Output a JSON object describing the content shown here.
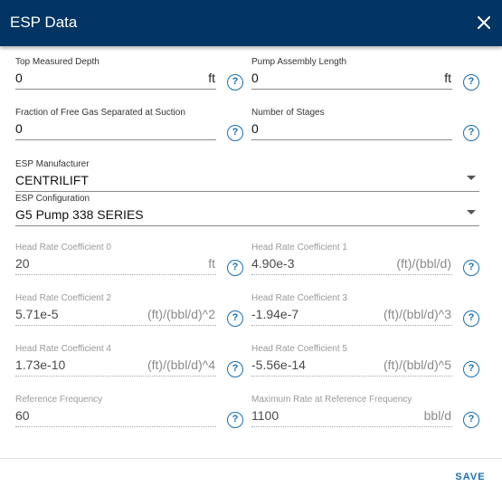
{
  "dialog": {
    "title": "ESP Data",
    "save_label": "SAVE"
  },
  "fields": {
    "top_measured_depth": {
      "label": "Top Measured Depth",
      "value": "0",
      "unit": "ft"
    },
    "pump_assembly_length": {
      "label": "Pump Assembly Length",
      "value": "0",
      "unit": "ft"
    },
    "free_gas_fraction": {
      "label": "Fraction of Free Gas Separated at Suction",
      "value": "0"
    },
    "number_of_stages": {
      "label": "Number of Stages",
      "value": "0"
    },
    "esp_manufacturer": {
      "label": "ESP Manufacturer",
      "value": "CENTRILIFT"
    },
    "esp_configuration": {
      "label": "ESP Configuration",
      "value": "G5 Pump 338 SERIES"
    },
    "head_rate_coef_0": {
      "label": "Head Rate Coefficient 0",
      "value": "20",
      "unit": "ft"
    },
    "head_rate_coef_1": {
      "label": "Head Rate Coefficient 1",
      "value": "4.90e-3",
      "unit": "(ft)/(bbl/d)"
    },
    "head_rate_coef_2": {
      "label": "Head Rate Coefficient 2",
      "value": "5.71e-5",
      "unit": "(ft)/(bbl/d)^2"
    },
    "head_rate_coef_3": {
      "label": "Head Rate Coefficient 3",
      "value": "-1.94e-7",
      "unit": "(ft)/(bbl/d)^3"
    },
    "head_rate_coef_4": {
      "label": "Head Rate Coefficient 4",
      "value": "1.73e-10",
      "unit": "(ft)/(bbl/d)^4"
    },
    "head_rate_coef_5": {
      "label": "Head Rate Coefficient 5",
      "value": "-5.56e-14",
      "unit": "(ft)/(bbl/d)^5"
    },
    "reference_frequency": {
      "label": "Reference Frequency",
      "value": "60"
    },
    "max_rate_at_reference_frequency": {
      "label": "Maximum Rate at Reference Frequency",
      "value": "1100",
      "unit": "bbl/d"
    }
  },
  "icons": {
    "help": "help-circle-icon",
    "close": "close-icon",
    "dropdown": "chevron-down-icon"
  },
  "colors": {
    "header_background": "#023564",
    "accent": "#1a6fb0"
  }
}
